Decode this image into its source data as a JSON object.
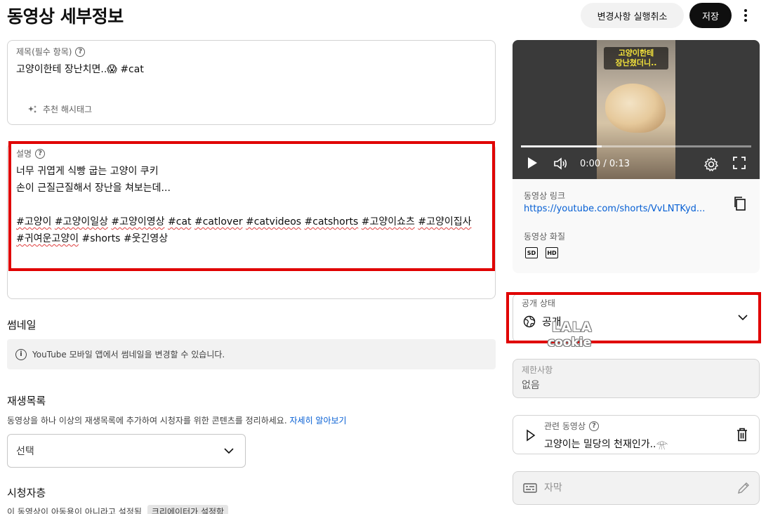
{
  "header": {
    "title": "동영상 세부정보",
    "undo_label": "변경사항 실행취소",
    "save_label": "저장"
  },
  "title_field": {
    "label": "제목(필수 항목)",
    "value": "고양이한테 장난치면..😱 #cat",
    "hashtag_button": "추천 해시태그"
  },
  "description": {
    "label": "설명",
    "line1": "너무 귀엽게 식빵 굽는 고양이 쿠키",
    "line2": "손이 근질근질해서 장난을 쳐보는데...",
    "tags_line1": [
      "#고양이",
      "#고양이일상",
      "#고양이영상",
      " #cat",
      "#catlover",
      "#catvideos",
      "#catshorts",
      "#고양이쇼츠",
      "#고양이집사"
    ],
    "tags_line2": [
      "#귀여운고양이",
      "#shorts",
      "#웃긴영상"
    ]
  },
  "thumbnail": {
    "heading": "썸네일",
    "notice": "YouTube 모바일 앱에서 썸네일을 변경할 수 있습니다."
  },
  "playlist": {
    "heading": "재생목록",
    "description": "동영상을 하나 이상의 재생목록에 추가하여 시청자를 위한 콘텐츠를 정리하세요.",
    "learn_more": "자세히 알아보기",
    "select_value": "선택"
  },
  "audience": {
    "heading": "시청자층",
    "text": "이 동영상이 아동용이 아니라고 설정됨",
    "chip": "크리에이터가 설정함"
  },
  "video": {
    "thumb_caption_line1": "고양이한테",
    "thumb_caption_line2": "장난쳤더니..",
    "time": "0:00 / 0:13",
    "progress": 0.35,
    "link_label": "동영상 링크",
    "link_value": "https://youtube.com/shorts/VvLNTKyd...",
    "quality_label": "동영상 화질",
    "quality_badges": [
      "SD",
      "HD"
    ]
  },
  "visibility": {
    "label": "공개 상태",
    "value": "공개"
  },
  "watermark": {
    "line1": "LALA",
    "line2": "cookie"
  },
  "restrictions": {
    "label": "제한사항",
    "value": "없음"
  },
  "related_video": {
    "label": "관련 동영상",
    "value": "고양이는 밀당의 천재인가..𓁿"
  },
  "captions": {
    "label": "자막"
  },
  "colors": {
    "highlight": "#e00000",
    "link": "#065fd4",
    "save_button": "#0f0f0f"
  }
}
